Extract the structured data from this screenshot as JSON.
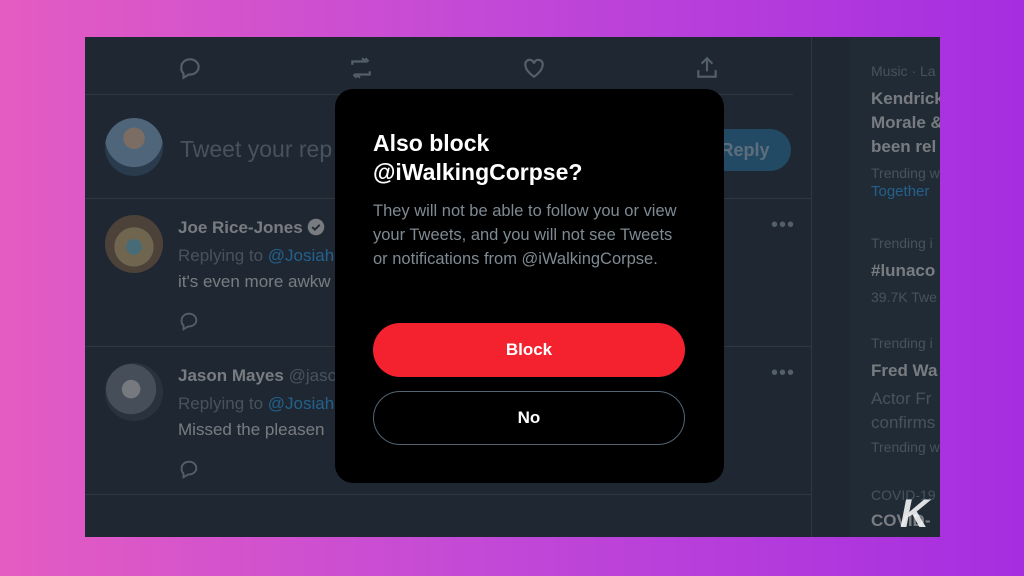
{
  "action_row": {
    "icons": [
      "comment-icon",
      "retweet-icon",
      "like-icon",
      "share-icon"
    ]
  },
  "reply_box": {
    "placeholder": "Tweet your rep",
    "button_label": "Reply"
  },
  "tweets": [
    {
      "name": "Joe Rice-Jones",
      "handle": "",
      "verified": true,
      "replying_prefix": "Replying to ",
      "replying_handle": "@Josiah",
      "text": "it's even more awkw"
    },
    {
      "name": "Jason Mayes",
      "handle": "@jaso",
      "verified": false,
      "replying_prefix": "Replying to ",
      "replying_handle": "@Josiah",
      "text": "Missed the pleasen"
    }
  ],
  "sidebar": {
    "trends": [
      {
        "meta": "Music · La",
        "title_lines": [
          "Kendrick",
          "Morale &",
          "been rel"
        ],
        "footer": "Trending w",
        "link": "Together"
      },
      {
        "meta": "Trending i",
        "title_lines": [
          "#lunaco"
        ],
        "footer": "39.7K Twe"
      },
      {
        "meta": "Trending i",
        "title_lines": [
          "Fred Wa"
        ],
        "sub_lines": [
          "Actor Fr",
          "confirms"
        ],
        "footer": "Trending w"
      },
      {
        "meta": "COVID-19",
        "title_lines": [
          "COVID-"
        ]
      }
    ]
  },
  "modal": {
    "title": "Also block\n@iWalkingCorpse?",
    "body": "They will not be able to follow you or view your Tweets, and you will not see Tweets or notifications from @iWalkingCorpse.",
    "block_label": "Block",
    "no_label": "No"
  },
  "colors": {
    "accent": "#1d9bf0",
    "danger": "#f4212e",
    "background": "#15202b"
  },
  "watermark": "K"
}
